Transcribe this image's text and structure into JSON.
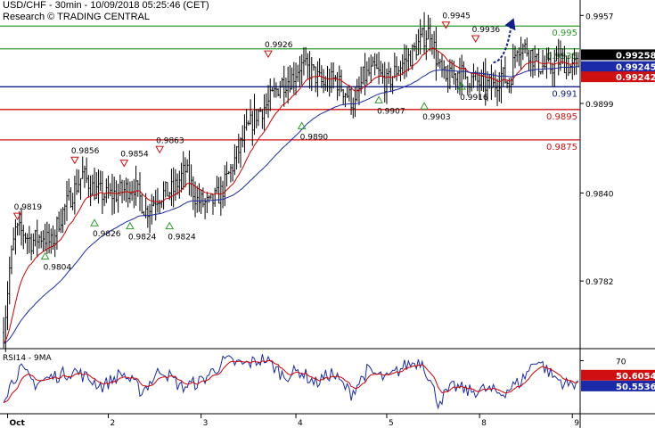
{
  "header": {
    "title": "USD/CHF - 30min - 10/09/2018 05:25:46 (CET)",
    "source": "Research © TRADING CENTRAL"
  },
  "rsi_label": "RSI14 - 9MA",
  "colors": {
    "price": "#000000",
    "ma_fast": "#d00000",
    "ma_slow": "#1a2aa8",
    "resistance": "#2e9b2e",
    "pivot": "#10208a",
    "support": "#d01010",
    "arrow": "#10208a",
    "badge_last": "#000000",
    "badge_ma_slow": "#1a2aa8",
    "badge_ma_fast": "#d01010"
  },
  "chart_data": [
    {
      "type": "candlestick",
      "title": "USD/CHF - 30min",
      "ylim": [
        0.9738,
        0.9966
      ],
      "yticks": [
        0.9957,
        0.9899,
        0.984,
        0.9782
      ],
      "x_labels": [
        {
          "label": "Oct",
          "bar": 2
        },
        {
          "label": "2",
          "bar": 53
        },
        {
          "label": "3",
          "bar": 100
        },
        {
          "label": "4",
          "bar": 148
        },
        {
          "label": "5",
          "bar": 194
        },
        {
          "label": "8",
          "bar": 241
        },
        {
          "label": "9",
          "bar": 288
        }
      ],
      "n_bars": 292,
      "anchors": [
        [
          0,
          0.9748
        ],
        [
          3,
          0.979
        ],
        [
          6,
          0.9815
        ],
        [
          10,
          0.9814
        ],
        [
          14,
          0.9808
        ],
        [
          20,
          0.9812
        ],
        [
          24,
          0.9806
        ],
        [
          28,
          0.9822
        ],
        [
          34,
          0.9838
        ],
        [
          40,
          0.9852
        ],
        [
          46,
          0.9842
        ],
        [
          52,
          0.9838
        ],
        [
          58,
          0.984
        ],
        [
          66,
          0.9845
        ],
        [
          72,
          0.9828
        ],
        [
          78,
          0.9838
        ],
        [
          86,
          0.9842
        ],
        [
          92,
          0.9855
        ],
        [
          98,
          0.9835
        ],
        [
          104,
          0.9832
        ],
        [
          110,
          0.984
        ],
        [
          116,
          0.9858
        ],
        [
          122,
          0.9878
        ],
        [
          128,
          0.9892
        ],
        [
          134,
          0.9899
        ],
        [
          140,
          0.9912
        ],
        [
          146,
          0.9916
        ],
        [
          150,
          0.9924
        ],
        [
          156,
          0.992
        ],
        [
          162,
          0.9911
        ],
        [
          168,
          0.9915
        ],
        [
          174,
          0.9905
        ],
        [
          178,
          0.9898
        ],
        [
          182,
          0.9916
        ],
        [
          188,
          0.9921
        ],
        [
          194,
          0.9912
        ],
        [
          200,
          0.9923
        ],
        [
          206,
          0.993
        ],
        [
          212,
          0.9942
        ],
        [
          216,
          0.9947
        ],
        [
          220,
          0.9924
        ],
        [
          224,
          0.9913
        ],
        [
          230,
          0.992
        ],
        [
          236,
          0.9915
        ],
        [
          242,
          0.9912
        ],
        [
          248,
          0.991
        ],
        [
          252,
          0.9918
        ],
        [
          256,
          0.9912
        ],
        [
          260,
          0.9938
        ],
        [
          266,
          0.9934
        ],
        [
          270,
          0.9925
        ],
        [
          276,
          0.9922
        ],
        [
          282,
          0.9928
        ],
        [
          288,
          0.9922
        ],
        [
          291,
          0.9925
        ]
      ],
      "ma_fast_period": 9,
      "ma_slow_period": 21,
      "levels": [
        {
          "value": 0.995,
          "label": "0.995",
          "kind": "resistance"
        },
        {
          "value": 0.9935,
          "label": "0.9935",
          "kind": "resistance"
        },
        {
          "value": 0.991,
          "label": "0.991",
          "kind": "pivot"
        },
        {
          "value": 0.9895,
          "label": "0.9895",
          "kind": "support"
        },
        {
          "value": 0.9875,
          "label": "0.9875",
          "kind": "support"
        }
      ],
      "badges": [
        {
          "value": 0.99258,
          "label": "0.99258",
          "kind": "badge_last"
        },
        {
          "value": 0.99245,
          "label": "0.99245",
          "kind": "badge_ma_slow"
        },
        {
          "value": 0.99242,
          "label": "0.99242",
          "kind": "badge_ma_fast"
        }
      ],
      "annotations": [
        {
          "bar": 7,
          "price": 0.9819,
          "label": "0.9819",
          "marker": "down",
          "kind": "high"
        },
        {
          "bar": 21,
          "price": 0.9804,
          "label": "0.9804",
          "marker": "up",
          "kind": "low"
        },
        {
          "bar": 36,
          "price": 0.9856,
          "label": "0.9856",
          "marker": "down",
          "kind": "high"
        },
        {
          "bar": 46,
          "price": 0.9826,
          "label": "0.9826",
          "marker": "up",
          "kind": "low"
        },
        {
          "bar": 61,
          "price": 0.9854,
          "label": "0.9854",
          "marker": "down",
          "kind": "high"
        },
        {
          "bar": 64,
          "price": 0.9824,
          "label": "0.9824",
          "marker": "up",
          "kind": "low"
        },
        {
          "bar": 79,
          "price": 0.9863,
          "label": "0.9863",
          "marker": "down",
          "kind": "high"
        },
        {
          "bar": 84,
          "price": 0.9824,
          "label": "0.9824",
          "marker": "up",
          "kind": "low"
        },
        {
          "bar": 134,
          "price": 0.9926,
          "label": "0.9926",
          "marker": "down",
          "kind": "high"
        },
        {
          "bar": 151,
          "price": 0.989,
          "label": "0.9890",
          "marker": "up",
          "kind": "low"
        },
        {
          "bar": 190,
          "price": 0.9907,
          "label": "0.9907",
          "marker": "up",
          "kind": "low"
        },
        {
          "bar": 213,
          "price": 0.9903,
          "label": "0.9903",
          "marker": "up",
          "kind": "low"
        },
        {
          "bar": 224,
          "price": 0.9945,
          "label": "0.9945",
          "marker": "down",
          "kind": "high"
        },
        {
          "bar": 239,
          "price": 0.9936,
          "label": "0.9936",
          "marker": "down",
          "kind": "high"
        },
        {
          "bar": 232,
          "price": 0.9916,
          "label": "0.9916",
          "marker": "up",
          "kind": "low"
        }
      ],
      "forecast_arrow": {
        "from_bar": 248,
        "from_price": 0.9926,
        "to_bar": 257,
        "to_price": 0.995
      }
    },
    {
      "type": "line",
      "title": "RSI14 - 9MA",
      "ylim": [
        20,
        80
      ],
      "yticks": [
        70
      ],
      "series": [
        {
          "name": "RSI14",
          "values_anchor": [
            [
              0,
              35
            ],
            [
              8,
              62
            ],
            [
              16,
              48
            ],
            [
              26,
              55
            ],
            [
              36,
              60
            ],
            [
              50,
              45
            ],
            [
              60,
              58
            ],
            [
              70,
              40
            ],
            [
              80,
              62
            ],
            [
              90,
              44
            ],
            [
              100,
              50
            ],
            [
              112,
              70
            ],
            [
              122,
              66
            ],
            [
              132,
              72
            ],
            [
              142,
              55
            ],
            [
              150,
              60
            ],
            [
              158,
              48
            ],
            [
              166,
              58
            ],
            [
              176,
              38
            ],
            [
              184,
              60
            ],
            [
              194,
              52
            ],
            [
              204,
              66
            ],
            [
              212,
              70
            ],
            [
              220,
              30
            ],
            [
              228,
              45
            ],
            [
              236,
              40
            ],
            [
              244,
              42
            ],
            [
              252,
              38
            ],
            [
              262,
              50
            ],
            [
              270,
              72
            ],
            [
              278,
              55
            ],
            [
              286,
              46
            ],
            [
              291,
              50.55
            ]
          ]
        },
        {
          "name": "9MA"
        }
      ],
      "badges": [
        {
          "value": 50.6054,
          "label": "50.6054",
          "kind": "badge_ma_fast"
        },
        {
          "value": 50.5536,
          "label": "50.5536",
          "kind": "badge_ma_slow"
        }
      ]
    }
  ]
}
